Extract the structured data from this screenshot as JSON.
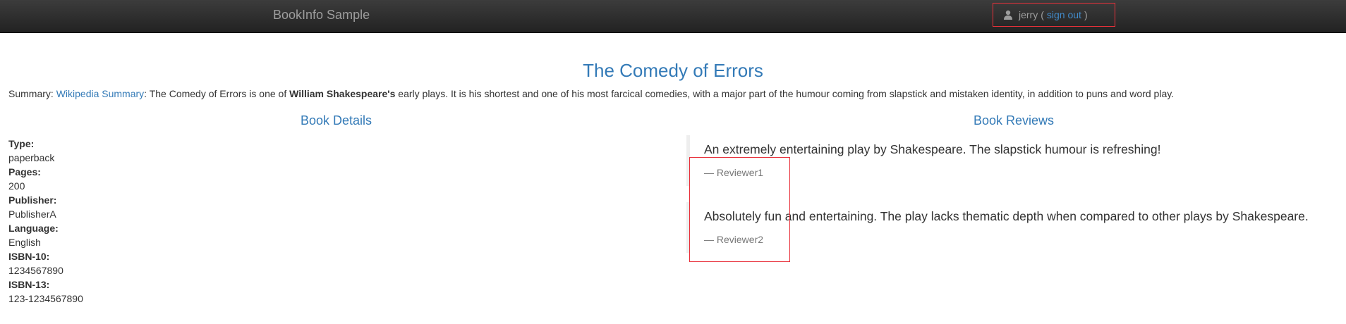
{
  "navbar": {
    "brand": "BookInfo Sample",
    "user": {
      "name": "jerry",
      "open_paren": "(",
      "signout_label": "sign out",
      "close_paren": ")"
    }
  },
  "book": {
    "title": "The Comedy of Errors",
    "summary": {
      "label": "Summary:",
      "link_text": "Wikipedia Summary",
      "text_before": ": The Comedy of Errors is one of",
      "author_bold": "William Shakespeare's",
      "text_after": "early plays. It is his shortest and one of his most farcical comedies, with a major part of the humour coming from slapstick and mistaken identity, in addition to puns and word play."
    }
  },
  "details": {
    "heading": "Book Details",
    "items": [
      {
        "label": "Type:",
        "value": "paperback"
      },
      {
        "label": "Pages:",
        "value": "200"
      },
      {
        "label": "Publisher:",
        "value": "PublisherA"
      },
      {
        "label": "Language:",
        "value": "English"
      },
      {
        "label": "ISBN-10:",
        "value": "1234567890"
      },
      {
        "label": "ISBN-13:",
        "value": "123-1234567890"
      }
    ]
  },
  "reviews": {
    "heading": "Book Reviews",
    "items": [
      {
        "text": "An extremely entertaining play by Shakespeare. The slapstick humour is refreshing!",
        "author": "— Reviewer1"
      },
      {
        "text": "Absolutely fun and entertaining. The play lacks thematic depth when compared to other plays by Shakespeare.",
        "author": "— Reviewer2"
      }
    ]
  },
  "icons": {
    "user": "user-icon"
  },
  "colors": {
    "navbar_bg": "#222222",
    "link": "#337ab7",
    "highlight": "#e8303a"
  }
}
